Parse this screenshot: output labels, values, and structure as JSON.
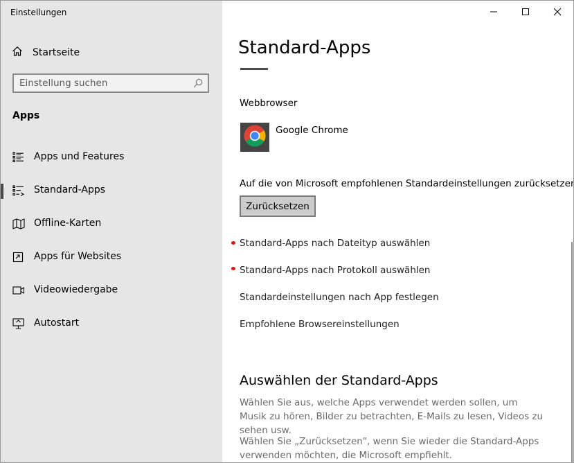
{
  "window": {
    "title": "Einstellungen"
  },
  "sidebar": {
    "home_label": "Startseite",
    "search_placeholder": "Einstellung suchen",
    "section_label": "Apps",
    "items": [
      {
        "label": "Apps und Features",
        "icon": "apps-features-icon"
      },
      {
        "label": "Standard-Apps",
        "icon": "default-apps-icon",
        "selected": true
      },
      {
        "label": "Offline-Karten",
        "icon": "offline-maps-icon"
      },
      {
        "label": "Apps für Websites",
        "icon": "apps-for-websites-icon"
      },
      {
        "label": "Videowiedergabe",
        "icon": "video-playback-icon"
      },
      {
        "label": "Autostart",
        "icon": "startup-icon"
      }
    ]
  },
  "main": {
    "title": "Standard-Apps",
    "webbrowser_label": "Webbrowser",
    "browser_name": "Google Chrome",
    "reset_text": "Auf die von Microsoft empfohlenen Standardeinstellungen zurücksetzen",
    "reset_button": "Zurücksetzen",
    "links": [
      "Standard-Apps nach Dateityp auswählen",
      "Standard-Apps nach Protokoll auswählen",
      "Standardeinstellungen nach App festlegen",
      "Empfohlene Browsereinstellungen"
    ],
    "section2_title": "Auswählen der Standard-Apps",
    "desc1": "Wählen Sie aus, welche Apps verwendet werden sollen, um Musik zu hören, Bilder zu betrachten, E-Mails zu lesen, Videos zu sehen usw.",
    "desc2": "Wählen Sie „Zurücksetzen\", wenn Sie wieder die Standard-Apps verwenden möchten, die Microsoft empfiehlt."
  },
  "colors": {
    "sidebar_bg": "#e6e6e6",
    "selection_bar": "#4a4a4a",
    "annotation_dot": "#e01010"
  }
}
